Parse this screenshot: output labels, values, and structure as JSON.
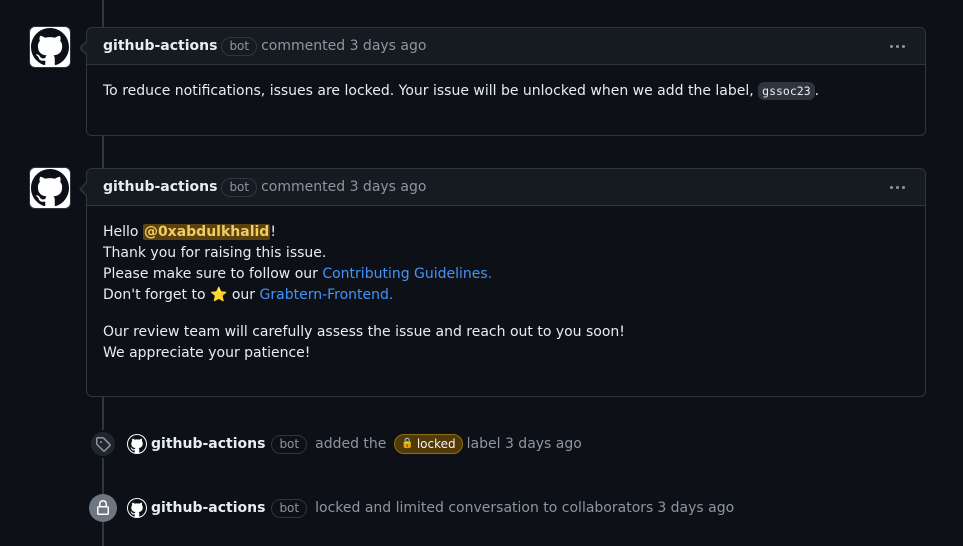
{
  "comments": [
    {
      "author": "github-actions",
      "badge": "bot",
      "action": "commented",
      "time": "3 days ago",
      "body": {
        "text": "To reduce notifications, issues are locked. Your issue will be unlocked when we add the label, ",
        "code": "gssoc23",
        "after": "."
      }
    },
    {
      "author": "github-actions",
      "badge": "bot",
      "action": "commented",
      "time": "3 days ago",
      "body": {
        "hello": "Hello ",
        "mention": "@0xabdulkhalid",
        "exclaim": "!",
        "line2": "Thank you for raising this issue.",
        "line3_pre": "Please make sure to follow our ",
        "line3_link": "Contributing Guidelines.",
        "line4_pre": "Don't forget to ",
        "line4_star": "⭐",
        "line4_mid": " our ",
        "line4_link": "Grabtern-Frontend.",
        "para2_line1": "Our review team will carefully assess the issue and reach out to you soon!",
        "para2_line2": "We appreciate your patience!"
      }
    }
  ],
  "events": [
    {
      "icon": "tag-icon",
      "author": "github-actions",
      "badge": "bot",
      "pre": "added the",
      "label": "locked",
      "label_emoji": "🔒",
      "post": "label",
      "time": "3 days ago"
    },
    {
      "icon": "lock-icon",
      "author": "github-actions",
      "badge": "bot",
      "text": "locked and limited conversation to collaborators",
      "time": "3 days ago"
    }
  ],
  "colors": {
    "background": "#0d1117",
    "border": "#30363d",
    "link": "#4493f8",
    "muted": "#8d96a0"
  }
}
